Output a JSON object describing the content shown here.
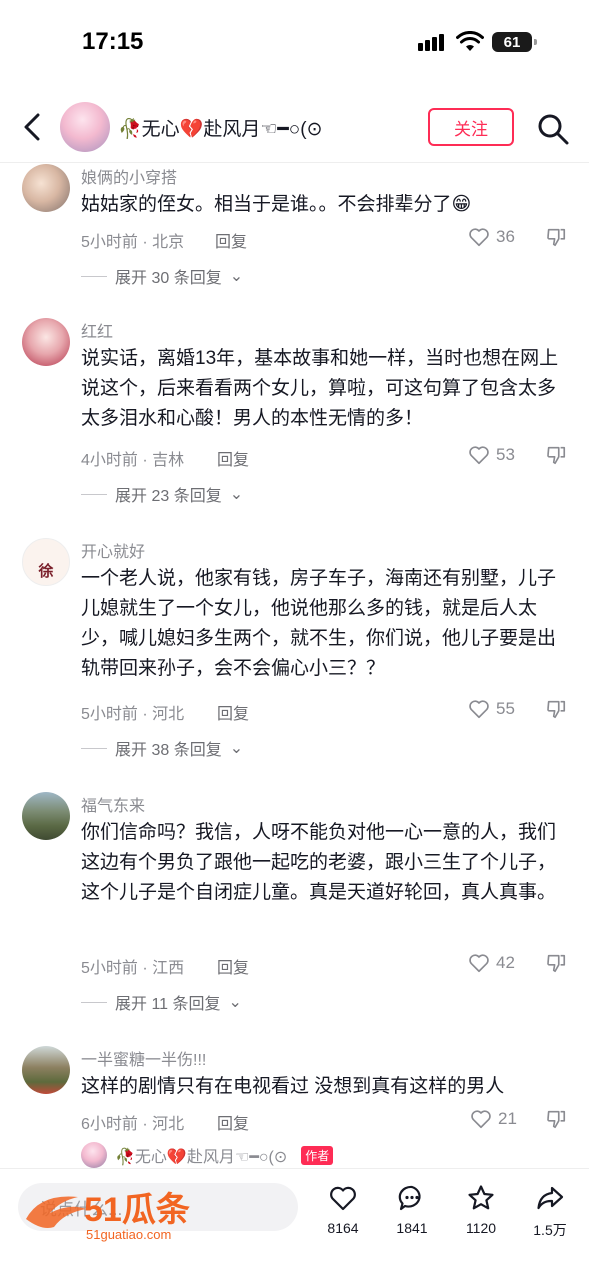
{
  "status_bar": {
    "time": "17:15",
    "battery": "61"
  },
  "header": {
    "name": "🥀无心💔赴风月☜━○(⊙",
    "follow_label": "关注"
  },
  "comments": [
    {
      "user": "娘俩的小穿搭",
      "text": "姑姑家的侄女。相当于是谁。。不会排辈分了😁",
      "meta": "5小时前 · 北京",
      "reply": "回复",
      "likes": "36",
      "expand": "展开 30 条回复"
    },
    {
      "user": "红红",
      "text": "说实话，离婚13年，基本故事和她一样，当时也想在网上说这个，后来看看两个女儿，算啦，可这句算了包含太多太多泪水和心酸！男人的本性无情的多！",
      "meta": "4小时前 · 吉林",
      "reply": "回复",
      "likes": "53",
      "expand": "展开 23 条回复"
    },
    {
      "user": "开心就好",
      "avatar_text": "徐",
      "text": "一个老人说，他家有钱，房子车子，海南还有别墅，儿子儿媳就生了一个女儿，他说他那么多的钱，就是后人太少，喊儿媳妇多生两个，就不生，你们说，他儿子要是出轨带回来孙子，会不会偏心小三？？",
      "meta": "5小时前 · 河北",
      "reply": "回复",
      "likes": "55",
      "expand": "展开 38 条回复"
    },
    {
      "user": "福气东来",
      "text": "你们信命吗？我信，人呀不能负对他一心一意的人，我们这边有个男负了跟他一起吃的老婆，跟小三生了个儿子，这个儿子是个自闭症儿童。真是天道好轮回，真人真事。",
      "meta": "5小时前 · 江西",
      "reply": "回复",
      "likes": "42",
      "expand": "展开 11 条回复"
    },
    {
      "user": "一半蜜糖一半伤!!!",
      "text": "这样的剧情只有在电视看过 没想到真有这样的男人",
      "meta": "6小时前 · 河北",
      "reply": "回复",
      "likes": "21"
    }
  ],
  "author_reply": {
    "name": "🥀无心💔赴风月☜━○(⊙",
    "tag": "作者"
  },
  "bottom": {
    "input_placeholder": "说点什么...",
    "watermark": "51瓜条",
    "watermark_url": "51guatiao.com",
    "likes": "8164",
    "comments": "1841",
    "favorites": "1120",
    "shares": "1.5万"
  },
  "colors": {
    "accent": "#fe2c55",
    "muted": "#8a8b91",
    "watermark": "#f26522"
  }
}
